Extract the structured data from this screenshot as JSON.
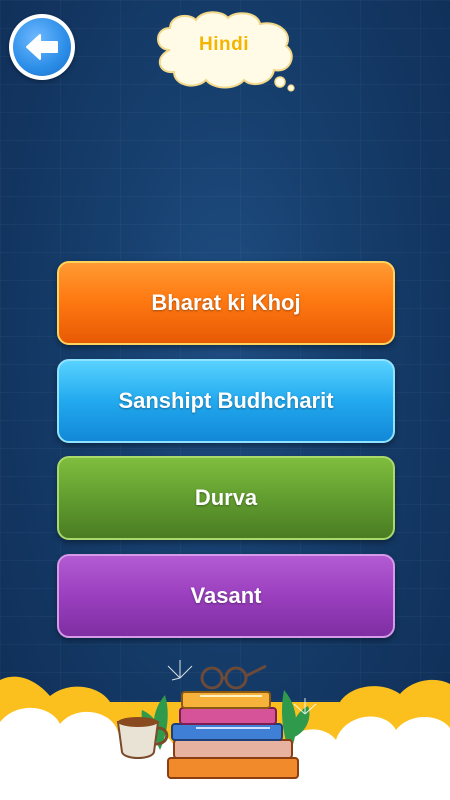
{
  "header": {
    "back_icon": "arrow-left-icon",
    "title": "Hindi"
  },
  "menu": {
    "items": [
      {
        "label": "Bharat ki Khoj",
        "color": "#ff7a12"
      },
      {
        "label": "Sanshipt Budhcharit",
        "color": "#22a9ee"
      },
      {
        "label": "Durva",
        "color": "#5f9a2e"
      },
      {
        "label": "Vasant",
        "color": "#9a3fbe"
      }
    ]
  },
  "decoration": {
    "icons": [
      "cloud-icon",
      "books-stack-icon",
      "tea-cup-icon",
      "eyeglasses-icon",
      "plant-icon"
    ]
  },
  "colors": {
    "background": "#17406f",
    "title_text": "#f4b400",
    "bottom_cloud": "#fbbf1e"
  }
}
